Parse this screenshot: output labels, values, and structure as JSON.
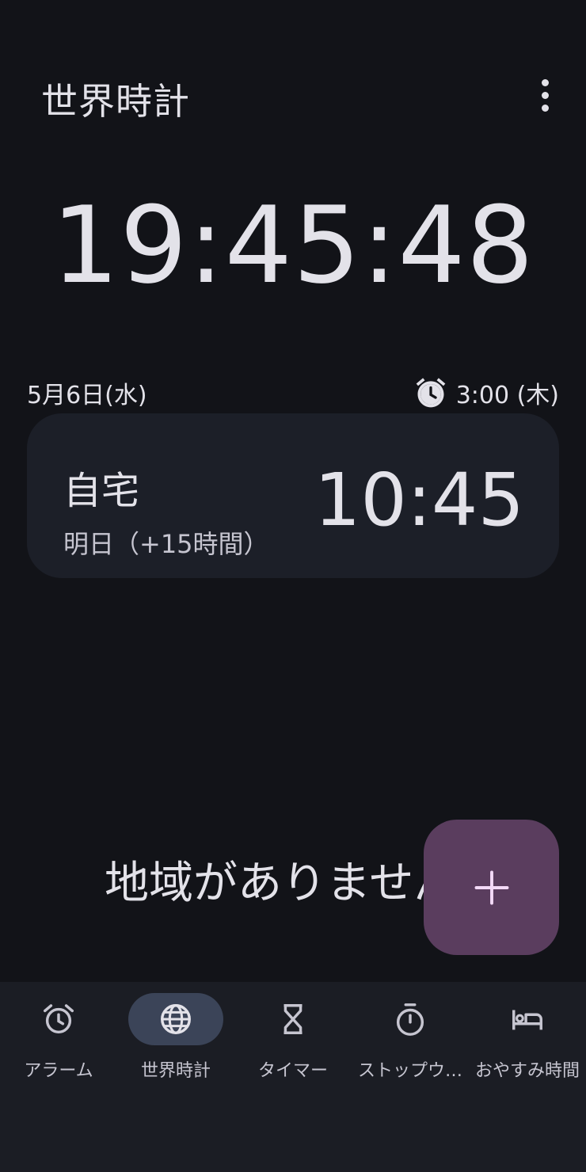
{
  "header": {
    "title": "世界時計",
    "menu_icon": "more-vert-icon"
  },
  "clock": {
    "time": "19:45:48",
    "date": "5月6日(水)",
    "next_alarm": "3:00 (木)",
    "next_alarm_icon": "alarm-icon"
  },
  "cities": [
    {
      "name": "自宅",
      "offset": "明日（+15時間）",
      "time": "10:45"
    }
  ],
  "empty_message": "地域がありません",
  "fab": {
    "icon": "plus-icon",
    "color": "#5a3d5e"
  },
  "bottom_nav": {
    "items": [
      {
        "label": "アラーム",
        "icon": "alarm-icon",
        "active": false
      },
      {
        "label": "世界時計",
        "icon": "globe-icon",
        "active": true
      },
      {
        "label": "タイマー",
        "icon": "hourglass-icon",
        "active": false
      },
      {
        "label": "ストップウ…",
        "icon": "stopwatch-icon",
        "active": false
      },
      {
        "label": "おやすみ時間",
        "icon": "bed-icon",
        "active": false
      }
    ],
    "active_color": "#3b4458"
  },
  "colors": {
    "background": "#121318",
    "card": "#1c1f28",
    "text": "#e3e2e9"
  }
}
